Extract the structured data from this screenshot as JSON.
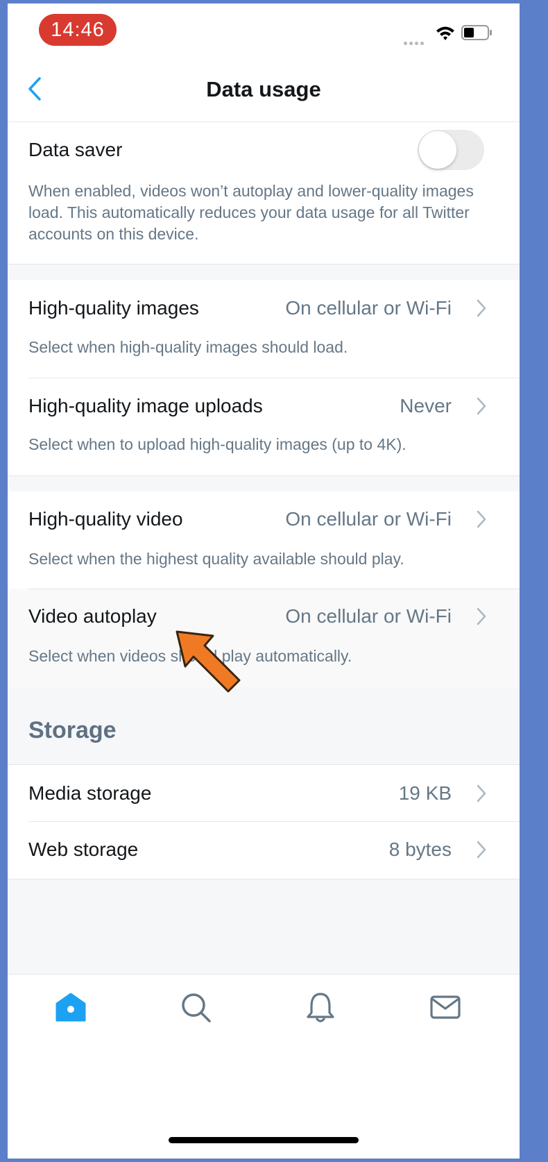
{
  "status_bar": {
    "time": "14:46"
  },
  "nav": {
    "title": "Data usage"
  },
  "data_saver": {
    "title": "Data saver",
    "enabled": false,
    "description": "When enabled, videos won’t autoplay and lower-quality images load. This automatically reduces your data usage for all Twitter accounts on this device."
  },
  "image_settings": [
    {
      "title": "High-quality images",
      "value": "On cellular or Wi-Fi",
      "description": "Select when high-quality images should load."
    },
    {
      "title": "High-quality image uploads",
      "value": "Never",
      "description": "Select when to upload high-quality images (up to 4K)."
    }
  ],
  "video_settings": [
    {
      "title": "High-quality video",
      "value": "On cellular or Wi-Fi",
      "description": "Select when the highest quality available should play."
    },
    {
      "title": "Video autoplay",
      "value": "On cellular or Wi-Fi",
      "description": "Select when videos should play automatically."
    }
  ],
  "storage": {
    "header": "Storage",
    "items": [
      {
        "title": "Media storage",
        "value": "19 KB"
      },
      {
        "title": "Web storage",
        "value": "8 bytes"
      }
    ]
  },
  "tabs": [
    {
      "icon": "home-icon",
      "active": true
    },
    {
      "icon": "search-icon",
      "active": false
    },
    {
      "icon": "bell-icon",
      "active": false
    },
    {
      "icon": "mail-icon",
      "active": false
    }
  ],
  "colors": {
    "accent": "#1da1f2",
    "time_pill": "#d93a30",
    "annotation_arrow": "#f07a24"
  }
}
